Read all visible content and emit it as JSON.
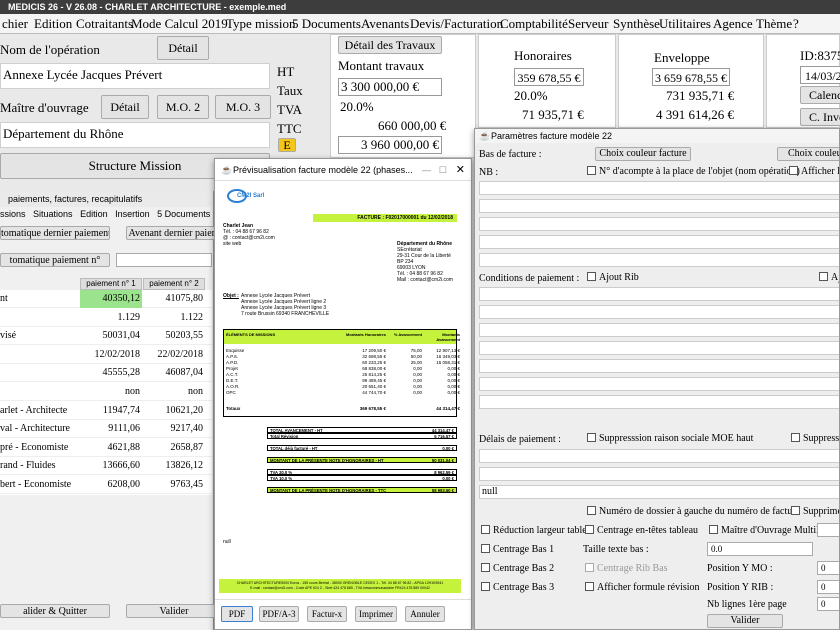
{
  "app": {
    "title": "MEDICIS 26 - V 26.08 - CHARLET ARCHITECTURE - exemple.med"
  },
  "menu": [
    "chier",
    "Edition",
    "Cotraitants",
    "Mode Calcul 2019",
    "Type mission",
    "5 Documents",
    "Avenants",
    "Devis/Facturation",
    "Comptabilité",
    "Serveur",
    "Synthèse",
    "Utilitaires",
    "Agence",
    "Thème",
    "?"
  ],
  "form": {
    "operation_label": "Nom de l'opération",
    "detail_btn": "Détail",
    "operation_value": "Annexe Lycée Jacques Prévert",
    "mo_label": "Maître d'ouvrage",
    "mo_detail_btn": "Détail",
    "mo2_btn": "M.O. 2",
    "mo3_btn": "M.O. 3",
    "mo_value": "Département du Rhône",
    "structure_btn": "Structure Mission"
  },
  "travaux": {
    "detail_btn": "Détail des Travaux",
    "montant_label": "Montant travaux",
    "montant_value": "3 300 000,00 €",
    "tva_rate": "20.0%",
    "tva_value": "660 000,00 €",
    "ttc_value": "3 960 000,00 €",
    "label_ht": "HT",
    "label_taux": "Taux",
    "label_tva": "TVA",
    "label_ttc": "TTC",
    "e_btn": "E"
  },
  "honoraires": {
    "label": "Honoraires",
    "ht": "359 678,55 €",
    "rate": "20.0%",
    "tva": "71 935,71 €"
  },
  "enveloppe": {
    "label": "Enveloppe",
    "ht": "3 659 678,55 €",
    "tva": "731 935,71 €",
    "ttc": "4 391 614,26 €"
  },
  "id_panel": {
    "id": "ID:8375",
    "date": "14/03/2",
    "cal_btn": "Calenc",
    "inv_btn": "C. Inve"
  },
  "sub1": {
    "title": "paiements, factures, recapitulatifs",
    "menu": [
      "ssions",
      "Situations",
      "Edition",
      "Insertion",
      "5 Documents"
    ],
    "btn_auto": "tomatique dernier paiement",
    "btn_avenant": "Avenant dernier paiem",
    "btn_auto_n": "tomatique paiement n°",
    "col1": "paiement n° 1",
    "col2": "paiement n° 2",
    "rows": [
      {
        "label": "nt",
        "v1": "40350,12",
        "v2": "41075,80"
      },
      {
        "label": "",
        "v1": "1.129",
        "v2": "1.122"
      },
      {
        "label": "visé",
        "v1": "50031,04",
        "v2": "50203,55"
      },
      {
        "label": "",
        "v1": "12/02/2018",
        "v2": "22/02/2018"
      },
      {
        "label": "",
        "v1": "45555,28",
        "v2": "46087,04"
      },
      {
        "label": "",
        "v1": "non",
        "v2": "non"
      },
      {
        "label": "arlet - Architecte",
        "v1": "11947,74",
        "v2": "10621,20"
      },
      {
        "label": "val - Architecture",
        "v1": "9111,06",
        "v2": "9217,40"
      },
      {
        "label": "pré - Economiste",
        "v1": "4621,88",
        "v2": "2658,87"
      },
      {
        "label": "rand - Fluides",
        "v1": "13666,60",
        "v2": "13826,12"
      },
      {
        "label": "bert - Economiste",
        "v1": "6208,00",
        "v2": "9763,45"
      }
    ],
    "validate_quit": "alider & Quitter",
    "validate": "Valider"
  },
  "preview": {
    "title": "Prévisualisation facture modèle 22 (phases...",
    "logo": "CM2I Sarl",
    "sender": [
      "Charlet Jean",
      "Tél. : 04 88 67 96 82",
      "@ : contact@cm2i.com",
      "site web"
    ],
    "invoice_no": "FACTURE : F02017000001 du 12/02/2018",
    "recipient": [
      "Département du Rhône",
      "SEcrétariat",
      "29-31 Cour de la Liberté",
      "BP 234",
      "69003 LYON",
      "Tél. : 04 88 67 96 82",
      "Mail : contact@cm2i.com"
    ],
    "objet_label": "Objet :",
    "objet": [
      "Annexe Lycée Jacques Prévert",
      "Annexe Lycée Jacques Prévert ligne 2",
      "Annexe Lycée Jacques Prévert ligne 3",
      "7 route Brussin 69340 FRANCHEVILLE"
    ],
    "table_headers": [
      "ÉLÉMENTS DE MISSIONS",
      "Montants Honoraires",
      "% Avancement",
      "Montants Avancement"
    ],
    "phases": [
      [
        "Esquisse",
        "17 209,50 €",
        "75,00",
        "12 907,13 €"
      ],
      [
        "A.P.S.",
        "32 698,55 €",
        "50,00",
        "16 349,03 €"
      ],
      [
        "A.P.D.",
        "60 233,25 €",
        "25,00",
        "15 058,31 €"
      ],
      [
        "Projet",
        "68 838,00 €",
        "0,00",
        "0,00 €"
      ],
      [
        "A.C.T.",
        "25 814,25 €",
        "0,00",
        "0,00 €"
      ],
      [
        "D.E.T.",
        "99 489,45 €",
        "0,00",
        "0,00 €"
      ],
      [
        "A.O.R.",
        "20 651,40 €",
        "0,00",
        "0,00 €"
      ],
      [
        "OPC",
        "44 744,70 €",
        "0,00",
        "0,00 €"
      ]
    ],
    "totaux": [
      "Totaux",
      "369 678,55 €",
      "",
      "44 314,47 €"
    ],
    "summary": [
      [
        "TOTAL AVANCEMENT - HT",
        "44 314,47 €"
      ],
      [
        "Total Révision",
        "5 716,57 €"
      ],
      [
        "TOTAL déjà facturé - HT",
        "0,00 €"
      ],
      [
        "MONTANT DE LA PRÉSENTE NOTE D'HONORAIRES - HT",
        "50 031,04 €"
      ],
      [
        "TVA 20.0 %",
        "8 962,59 €"
      ],
      [
        "TVA 10.0 %",
        "0,00 €"
      ],
      [
        "MONTANT DE LA PRÉSENTE NOTE D'HONORAIRES - TTC",
        "58 993,50 €"
      ]
    ],
    "null_text": "null",
    "footer1": "CHARLET ARCHITECTURE5000 Euros - 155 cours Berriat - 38000 GRENOBLE CEDEX 1 - Tél. 04 88 67 96 82 - APGA 12H1K5941",
    "footer2": "E-mail : contact@cm2i.com - Code APE 524 Z - Siret 424 478 889 - TVA intracommunautaire FR424 478 889 00042",
    "buttons": [
      "PDF",
      "PDF/A-3",
      "Factur-x",
      "Imprimer",
      "Annuler"
    ]
  },
  "param": {
    "title": "Paramètres facture modèle 22",
    "bas_label": "Bas de facture :",
    "choix_btn1": "Choix couleur facture",
    "choix_btn2": "Choix couleur",
    "nb_label": "NB :",
    "cb_acompte": "N° d'acompte à la place de l'objet (nom opération)",
    "cb_afficher": "Afficher le",
    "conditions_label": "Conditions de paiement :",
    "cb_rib": "Ajout Rib",
    "cb_ajout": "Ajou",
    "delais_label": "Délais de paiement :",
    "cb_suppr_moe": "Suppresssion raison sociale MOE haut",
    "cb_suppr2": "Suppressi",
    "null_value": "null",
    "cb_dossier": "Numéro de dossier à gauche du numéro de facture",
    "cb_supprimer": "Supprimer",
    "cb_reduction": "Réduction largeur table...",
    "cb_centrage_entetes": "Centrage en-têtes tableau",
    "cb_mo_multi": "Maître d'Ouvrage Multil...",
    "cb_bas1": "Centrage Bas 1",
    "taille_label": "Taille texte bas :",
    "taille_value": "0.0",
    "cb_bas2": "Centrage Bas 2",
    "cb_rib_bas": "Centrage Rib Bas",
    "pos_mo_label": "Position Y MO :",
    "pos_mo_value": "0",
    "cb_bas3": "Centrage Bas 3",
    "cb_formule": "Afficher formule révision",
    "pos_rib_label": "Position Y RIB :",
    "pos_rib_value": "0",
    "nb_lignes_label": "Nb lignes 1ère page",
    "nb_lignes_value": "0",
    "valider": "Valider"
  }
}
